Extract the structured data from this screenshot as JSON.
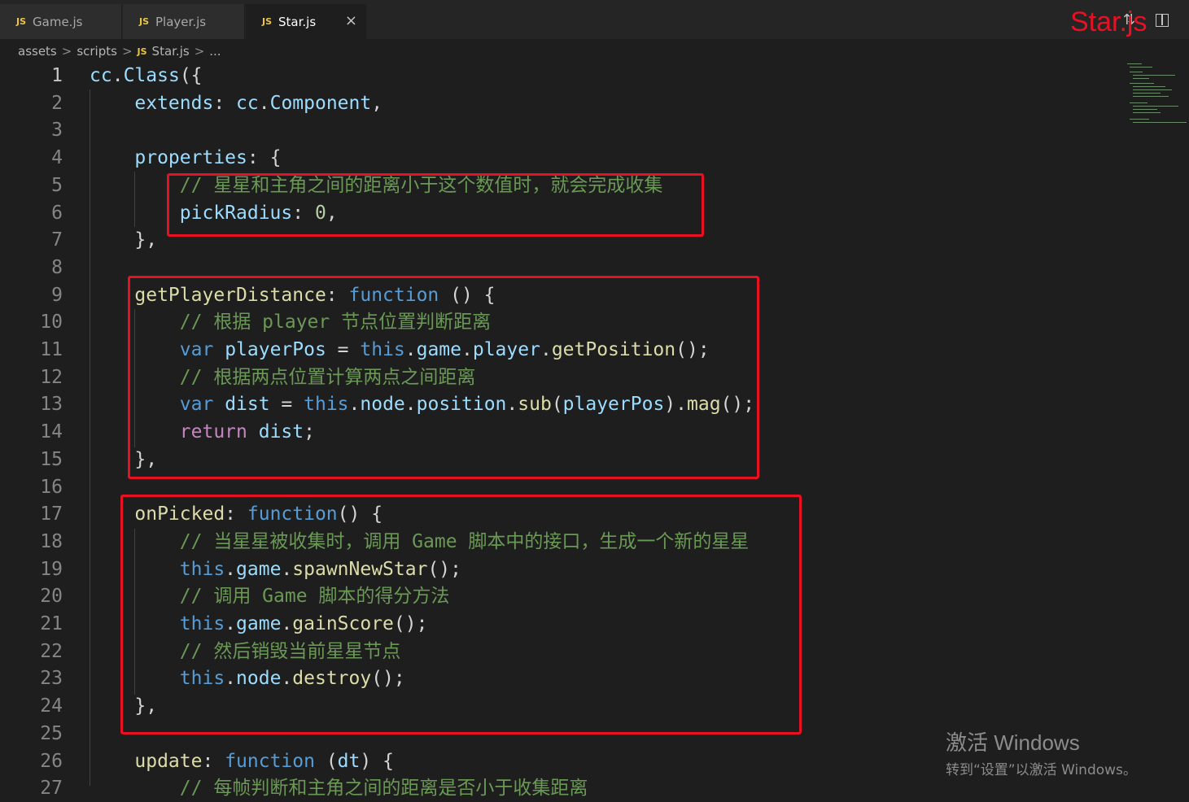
{
  "tabs": [
    {
      "badge": "JS",
      "label": "Game.js"
    },
    {
      "badge": "JS",
      "label": "Player.js"
    },
    {
      "badge": "JS",
      "label": "Star.js",
      "close": "×"
    }
  ],
  "overlay_title": "Star.js",
  "breadcrumb": {
    "parts": [
      "assets",
      "scripts"
    ],
    "badge": "JS",
    "file": "Star.js",
    "tail": "...",
    "sep": ">"
  },
  "lines": [
    {
      "n": "1",
      "tokens": [
        [
          "t-id",
          "cc"
        ],
        [
          "t-pl",
          "."
        ],
        [
          "t-id",
          "Class"
        ],
        [
          "t-pl",
          "({"
        ]
      ]
    },
    {
      "n": "2",
      "tokens": [
        [
          "t-pl",
          "    "
        ],
        [
          "t-id",
          "extends"
        ],
        [
          "t-pl",
          ": "
        ],
        [
          "t-id",
          "cc"
        ],
        [
          "t-pl",
          "."
        ],
        [
          "t-id",
          "Component"
        ],
        [
          "t-pl",
          ","
        ]
      ]
    },
    {
      "n": "3",
      "tokens": []
    },
    {
      "n": "4",
      "tokens": [
        [
          "t-pl",
          "    "
        ],
        [
          "t-id",
          "properties"
        ],
        [
          "t-pl",
          ": {"
        ]
      ]
    },
    {
      "n": "5",
      "tokens": [
        [
          "t-pl",
          "        "
        ],
        [
          "t-cm",
          "// 星星和主角之间的距离小于这个数值时，就会完成收集"
        ]
      ]
    },
    {
      "n": "6",
      "tokens": [
        [
          "t-pl",
          "        "
        ],
        [
          "t-id",
          "pickRadius"
        ],
        [
          "t-pl",
          ": "
        ],
        [
          "t-num",
          "0"
        ],
        [
          "t-pl",
          ","
        ]
      ]
    },
    {
      "n": "7",
      "tokens": [
        [
          "t-pl",
          "    },"
        ]
      ]
    },
    {
      "n": "8",
      "tokens": []
    },
    {
      "n": "9",
      "tokens": [
        [
          "t-pl",
          "    "
        ],
        [
          "t-fn",
          "getPlayerDistance"
        ],
        [
          "t-pl",
          ": "
        ],
        [
          "t-kw",
          "function"
        ],
        [
          "t-pl",
          " () {"
        ]
      ]
    },
    {
      "n": "10",
      "tokens": [
        [
          "t-pl",
          "        "
        ],
        [
          "t-cm",
          "// 根据 player 节点位置判断距离"
        ]
      ]
    },
    {
      "n": "11",
      "tokens": [
        [
          "t-pl",
          "        "
        ],
        [
          "t-kw",
          "var"
        ],
        [
          "t-pl",
          " "
        ],
        [
          "t-id",
          "playerPos"
        ],
        [
          "t-pl",
          " = "
        ],
        [
          "t-kw",
          "this"
        ],
        [
          "t-pl",
          "."
        ],
        [
          "t-id",
          "game"
        ],
        [
          "t-pl",
          "."
        ],
        [
          "t-id",
          "player"
        ],
        [
          "t-pl",
          "."
        ],
        [
          "t-fn",
          "getPosition"
        ],
        [
          "t-pl",
          "();"
        ]
      ]
    },
    {
      "n": "12",
      "tokens": [
        [
          "t-pl",
          "        "
        ],
        [
          "t-cm",
          "// 根据两点位置计算两点之间距离"
        ]
      ]
    },
    {
      "n": "13",
      "tokens": [
        [
          "t-pl",
          "        "
        ],
        [
          "t-kw",
          "var"
        ],
        [
          "t-pl",
          " "
        ],
        [
          "t-id",
          "dist"
        ],
        [
          "t-pl",
          " = "
        ],
        [
          "t-kw",
          "this"
        ],
        [
          "t-pl",
          "."
        ],
        [
          "t-id",
          "node"
        ],
        [
          "t-pl",
          "."
        ],
        [
          "t-id",
          "position"
        ],
        [
          "t-pl",
          "."
        ],
        [
          "t-fn",
          "sub"
        ],
        [
          "t-pl",
          "("
        ],
        [
          "t-id",
          "playerPos"
        ],
        [
          "t-pl",
          ")."
        ],
        [
          "t-fn",
          "mag"
        ],
        [
          "t-pl",
          "();"
        ]
      ]
    },
    {
      "n": "14",
      "tokens": [
        [
          "t-pl",
          "        "
        ],
        [
          "t-ret",
          "return"
        ],
        [
          "t-pl",
          " "
        ],
        [
          "t-id",
          "dist"
        ],
        [
          "t-pl",
          ";"
        ]
      ]
    },
    {
      "n": "15",
      "tokens": [
        [
          "t-pl",
          "    },"
        ]
      ]
    },
    {
      "n": "16",
      "tokens": []
    },
    {
      "n": "17",
      "tokens": [
        [
          "t-pl",
          "    "
        ],
        [
          "t-fn",
          "onPicked"
        ],
        [
          "t-pl",
          ": "
        ],
        [
          "t-kw",
          "function"
        ],
        [
          "t-pl",
          "() {"
        ]
      ]
    },
    {
      "n": "18",
      "tokens": [
        [
          "t-pl",
          "        "
        ],
        [
          "t-cm",
          "// 当星星被收集时，调用 Game 脚本中的接口，生成一个新的星星"
        ]
      ]
    },
    {
      "n": "19",
      "tokens": [
        [
          "t-pl",
          "        "
        ],
        [
          "t-kw",
          "this"
        ],
        [
          "t-pl",
          "."
        ],
        [
          "t-id",
          "game"
        ],
        [
          "t-pl",
          "."
        ],
        [
          "t-fn",
          "spawnNewStar"
        ],
        [
          "t-pl",
          "();"
        ]
      ]
    },
    {
      "n": "20",
      "tokens": [
        [
          "t-pl",
          "        "
        ],
        [
          "t-cm",
          "// 调用 Game 脚本的得分方法"
        ]
      ]
    },
    {
      "n": "21",
      "tokens": [
        [
          "t-pl",
          "        "
        ],
        [
          "t-kw",
          "this"
        ],
        [
          "t-pl",
          "."
        ],
        [
          "t-id",
          "game"
        ],
        [
          "t-pl",
          "."
        ],
        [
          "t-fn",
          "gainScore"
        ],
        [
          "t-pl",
          "();"
        ]
      ]
    },
    {
      "n": "22",
      "tokens": [
        [
          "t-pl",
          "        "
        ],
        [
          "t-cm",
          "// 然后销毁当前星星节点"
        ]
      ]
    },
    {
      "n": "23",
      "tokens": [
        [
          "t-pl",
          "        "
        ],
        [
          "t-kw",
          "this"
        ],
        [
          "t-pl",
          "."
        ],
        [
          "t-id",
          "node"
        ],
        [
          "t-pl",
          "."
        ],
        [
          "t-fn",
          "destroy"
        ],
        [
          "t-pl",
          "();"
        ]
      ]
    },
    {
      "n": "24",
      "tokens": [
        [
          "t-pl",
          "    },"
        ]
      ]
    },
    {
      "n": "25",
      "tokens": []
    },
    {
      "n": "26",
      "tokens": [
        [
          "t-pl",
          "    "
        ],
        [
          "t-fn",
          "update"
        ],
        [
          "t-pl",
          ": "
        ],
        [
          "t-kw",
          "function"
        ],
        [
          "t-pl",
          " ("
        ],
        [
          "t-id",
          "dt"
        ],
        [
          "t-pl",
          ") {"
        ]
      ]
    },
    {
      "n": "27",
      "tokens": [
        [
          "t-pl",
          "        "
        ],
        [
          "t-cm",
          "// 每帧判断和主角之间的距离是否小于收集距离"
        ]
      ]
    }
  ],
  "watermark": {
    "line1": "激活 Windows",
    "line2": "转到“设置”以激活 Windows。"
  }
}
